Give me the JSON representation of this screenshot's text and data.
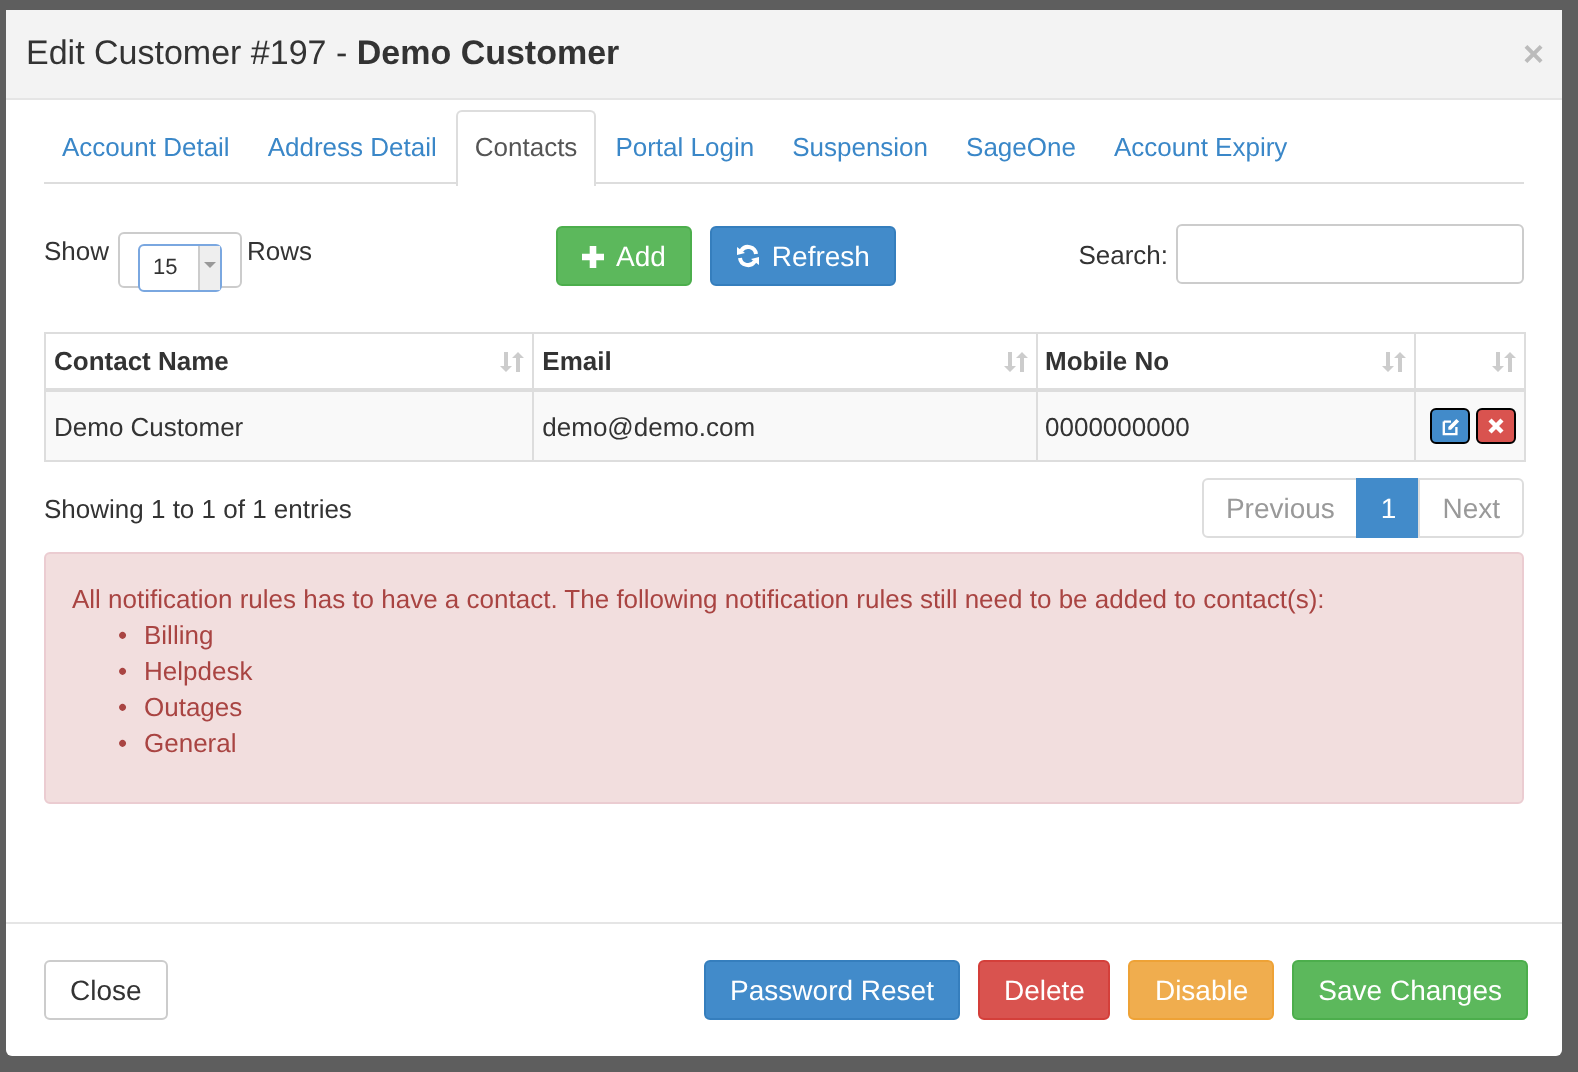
{
  "modal": {
    "title": "Edit Customer #197 - **Demo Customer**",
    "close": "×"
  },
  "tabs": [
    {
      "label": "Account Detail",
      "selected": false
    },
    {
      "label": "Address Detail",
      "selected": false
    },
    {
      "label": "Contacts",
      "selected": true
    },
    {
      "label": "Portal Login",
      "selected": false
    },
    {
      "label": "Suspension",
      "selected": false
    },
    {
      "label": "SageOne",
      "selected": false
    },
    {
      "label": "Account Expiry",
      "selected": false
    }
  ],
  "length": {
    "before": "Show",
    "value": "15",
    "after": "Rows"
  },
  "toolbar": [
    {
      "label": "Add",
      "kind": "add"
    },
    {
      "label": "Refresh",
      "kind": "refresh"
    }
  ],
  "search": {
    "label": "Search:"
  },
  "table": {
    "columns": [
      "Contact Name",
      "Email",
      "Mobile No",
      ""
    ],
    "rows": [
      {
        "cells": [
          "Demo Customer",
          "demo@demo.com",
          "0000000000"
        ],
        "actions": [
          {
            "kind": "edit"
          },
          {
            "kind": "delete"
          }
        ]
      }
    ]
  },
  "info": "Showing 1 to 1 of 1 entries",
  "pagination": [
    {
      "label": "Previous",
      "selected": false,
      "disabled": true
    },
    {
      "label": "1",
      "selected": true,
      "disabled": false
    },
    {
      "label": "Next",
      "selected": false,
      "disabled": true
    }
  ],
  "alert": {
    "message": "All notification rules has to have a contact. The following notification rules still need to be added to contact(s):",
    "items": [
      {
        "bullet": "•",
        "label": "Billing"
      },
      {
        "bullet": "•",
        "label": "Helpdesk"
      },
      {
        "bullet": "•",
        "label": "Outages"
      },
      {
        "bullet": "•",
        "label": "General"
      }
    ]
  },
  "footer": [
    {
      "label": "Close",
      "kind": "default"
    },
    {
      "label": "Password Reset",
      "kind": "primary"
    },
    {
      "label": "Delete",
      "kind": "danger"
    },
    {
      "label": "Disable",
      "kind": "warning"
    },
    {
      "label": "Save Changes",
      "kind": "success"
    }
  ]
}
